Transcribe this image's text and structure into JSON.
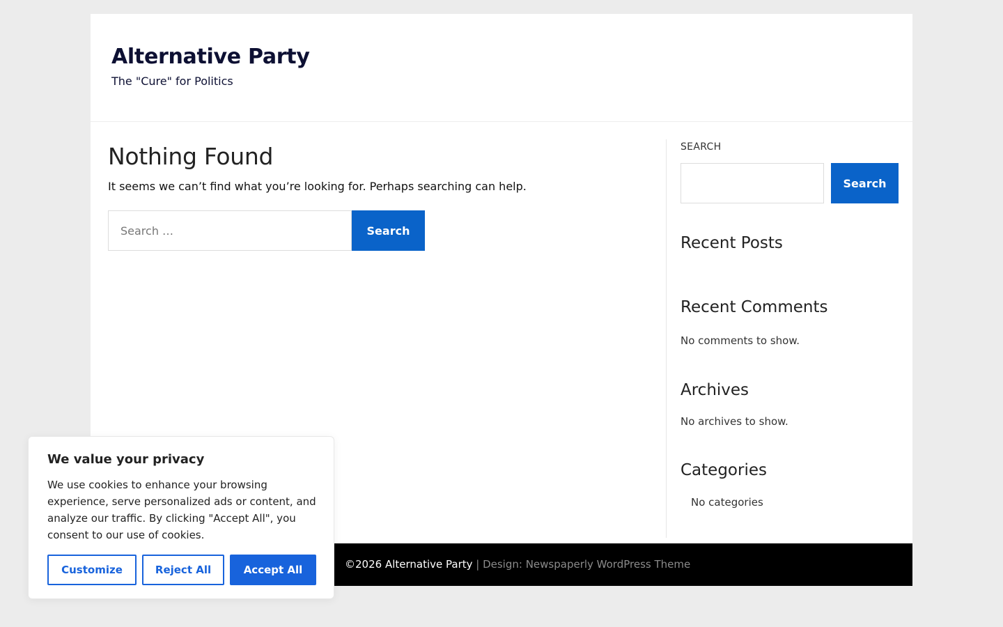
{
  "header": {
    "site_title": "Alternative Party",
    "tagline": "The \"Cure\" for Politics"
  },
  "main": {
    "title": "Nothing Found",
    "message": "It seems we can’t find what you’re looking for. Perhaps searching can help.",
    "search": {
      "placeholder": "Search …",
      "button_label": "Search"
    }
  },
  "sidebar": {
    "search_label": "SEARCH",
    "search_button_label": "Search",
    "recent_posts_title": "Recent Posts",
    "recent_comments_title": "Recent Comments",
    "recent_comments_text": "No comments to show.",
    "archives_title": "Archives",
    "archives_text": "No archives to show.",
    "categories_title": "Categories",
    "categories_text": "No categories"
  },
  "footer": {
    "copyright": "©2026 Alternative Party",
    "credit": " | Design: Newspaperly WordPress Theme"
  },
  "cookie_banner": {
    "title": "We value your privacy",
    "text": "We use cookies to enhance your browsing experience, serve personalized ads or content, and analyze our traffic. By clicking \"Accept All\", you consent to our use of cookies.",
    "customize_label": "Customize",
    "reject_label": "Reject All",
    "accept_label": "Accept All"
  },
  "colors": {
    "accent": "#0a63c9",
    "cookie_accent": "#1863dc",
    "page_background": "#ececec",
    "footer_background": "#000000"
  }
}
